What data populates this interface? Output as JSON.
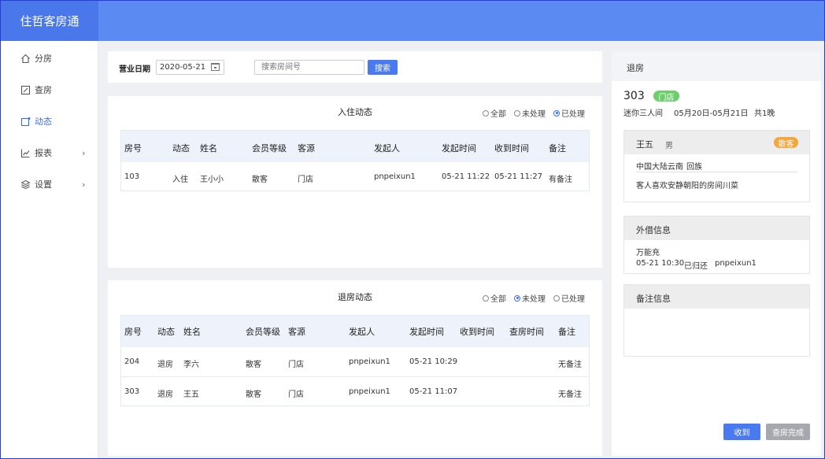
{
  "app": {
    "title": "住哲客房通"
  },
  "sidebar": {
    "items": [
      {
        "label": "分房",
        "icon": "home-icon"
      },
      {
        "label": "查房",
        "icon": "edit-icon"
      },
      {
        "label": "动态",
        "icon": "bell-icon",
        "active": true
      },
      {
        "label": "报表",
        "icon": "chart-icon",
        "arrow": "›"
      },
      {
        "label": "设置",
        "icon": "layers-icon",
        "arrow": "›"
      }
    ]
  },
  "toolbar": {
    "date_label": "营业日期",
    "date_value": "2020-05-21",
    "search_placeholder": "搜索房间号",
    "search_button": "搜索"
  },
  "checkin": {
    "title": "入住动态",
    "filters": [
      "全部",
      "未处理",
      "已处理"
    ],
    "selected": "已处理",
    "headers": [
      "房号",
      "动态",
      "姓名",
      "会员等级",
      "客源",
      "发起人",
      "发起时间",
      "收到时间",
      "备注"
    ],
    "rows": [
      [
        "103",
        "入住",
        "王小小",
        "散客",
        "门店",
        "pnpeixun1",
        "05-21 11:22",
        "05-21 11:27",
        "有备注"
      ]
    ]
  },
  "checkout": {
    "title": "退房动态",
    "filters": [
      "全部",
      "未处理",
      "已处理"
    ],
    "selected": "未处理",
    "headers": [
      "房号",
      "动态",
      "姓名",
      "会员等级",
      "客源",
      "发起人",
      "发起时间",
      "收到时间",
      "查房时间",
      "备注"
    ],
    "rows": [
      [
        "204",
        "退房",
        "李六",
        "散客",
        "门店",
        "pnpeixun1",
        "05-21 10:29",
        "",
        "",
        "无备注"
      ],
      [
        "303",
        "退房",
        "王五",
        "散客",
        "门店",
        "pnpeixun1",
        "05-21 11:07",
        "",
        "",
        "无备注"
      ]
    ]
  },
  "detail": {
    "title": "退房",
    "room": "303",
    "source_tag": "门店",
    "room_type": "迷你三人间",
    "dates": "05月20日-05月21日",
    "nights": "共1晚",
    "guest": {
      "name": "王五",
      "gender": "男",
      "tag": "散客",
      "origin": "中国大陆云南",
      "ethnicity": "回族",
      "note": "客人喜欢安静朝阳的房间川菜"
    },
    "borrow": {
      "title": "外借信息",
      "item": "万能充",
      "time": "05-21 10:30",
      "status": "已归还",
      "user": "pnpeixun1"
    },
    "remark": {
      "title": "备注信息"
    },
    "btn_receive": "收到",
    "btn_done": "查房完成"
  },
  "colors": {
    "header": "#5b8bf2",
    "accent": "#4a7af0",
    "green": "#6ccf6c",
    "orange": "#f5a53c"
  }
}
